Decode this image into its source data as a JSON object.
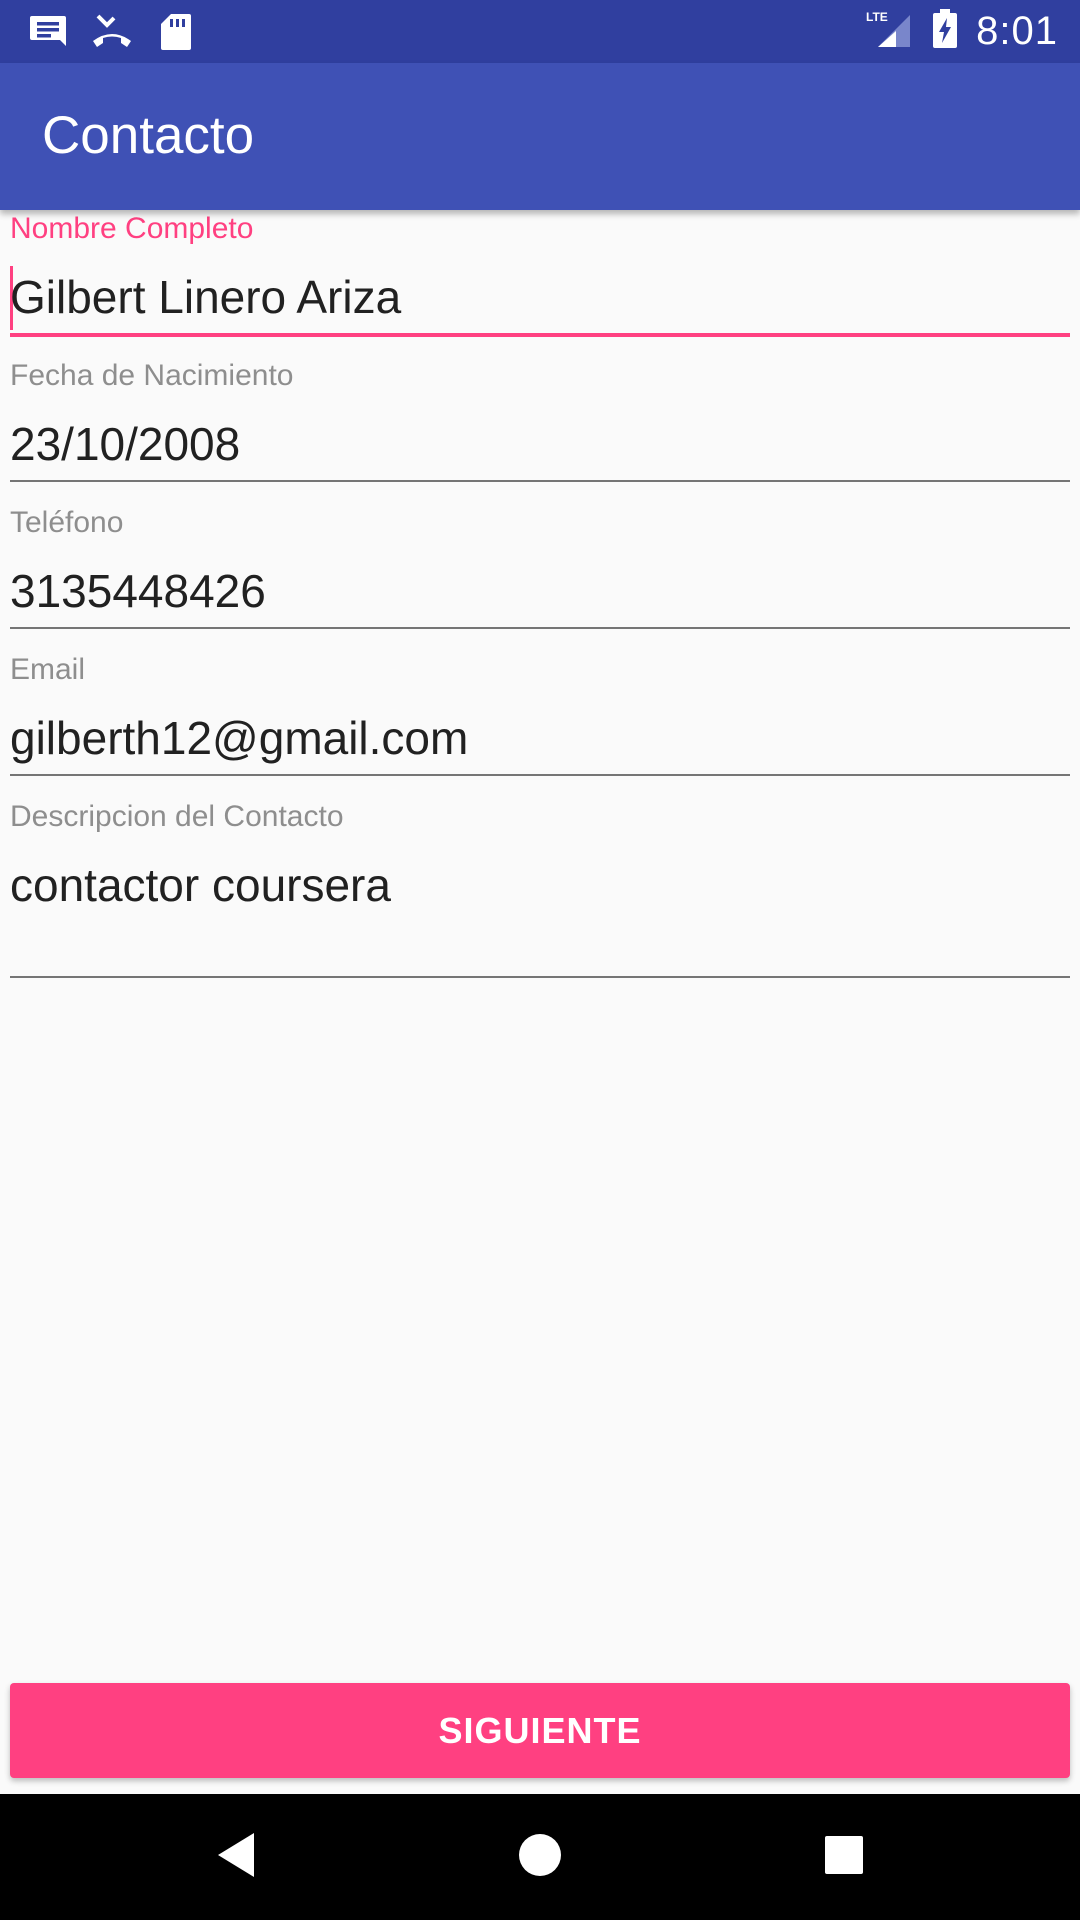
{
  "status_bar": {
    "time": "8:01",
    "network": "LTE",
    "left_icons": [
      "notification-message-icon",
      "missed-call-icon",
      "sd-card-icon"
    ],
    "color": "#303F9F"
  },
  "app_bar": {
    "title": "Contacto",
    "color": "#3F51B5"
  },
  "form": {
    "nombre": {
      "label": "Nombre Completo",
      "value": "Gilbert Linero Ariza",
      "focused": true
    },
    "fecha": {
      "label": "Fecha de Nacimiento",
      "value": "23/10/2008"
    },
    "telefono": {
      "label": "Teléfono",
      "value": "3135448426"
    },
    "email": {
      "label": "Email",
      "value": "gilberth12@gmail.com"
    },
    "descripcion": {
      "label": "Descripcion del Contacto",
      "value": "contactor coursera"
    }
  },
  "button": {
    "label": "SIGUIENTE",
    "color": "#FF4081"
  },
  "nav_bar": {
    "icons": [
      "back-icon",
      "home-icon",
      "recents-icon"
    ]
  }
}
